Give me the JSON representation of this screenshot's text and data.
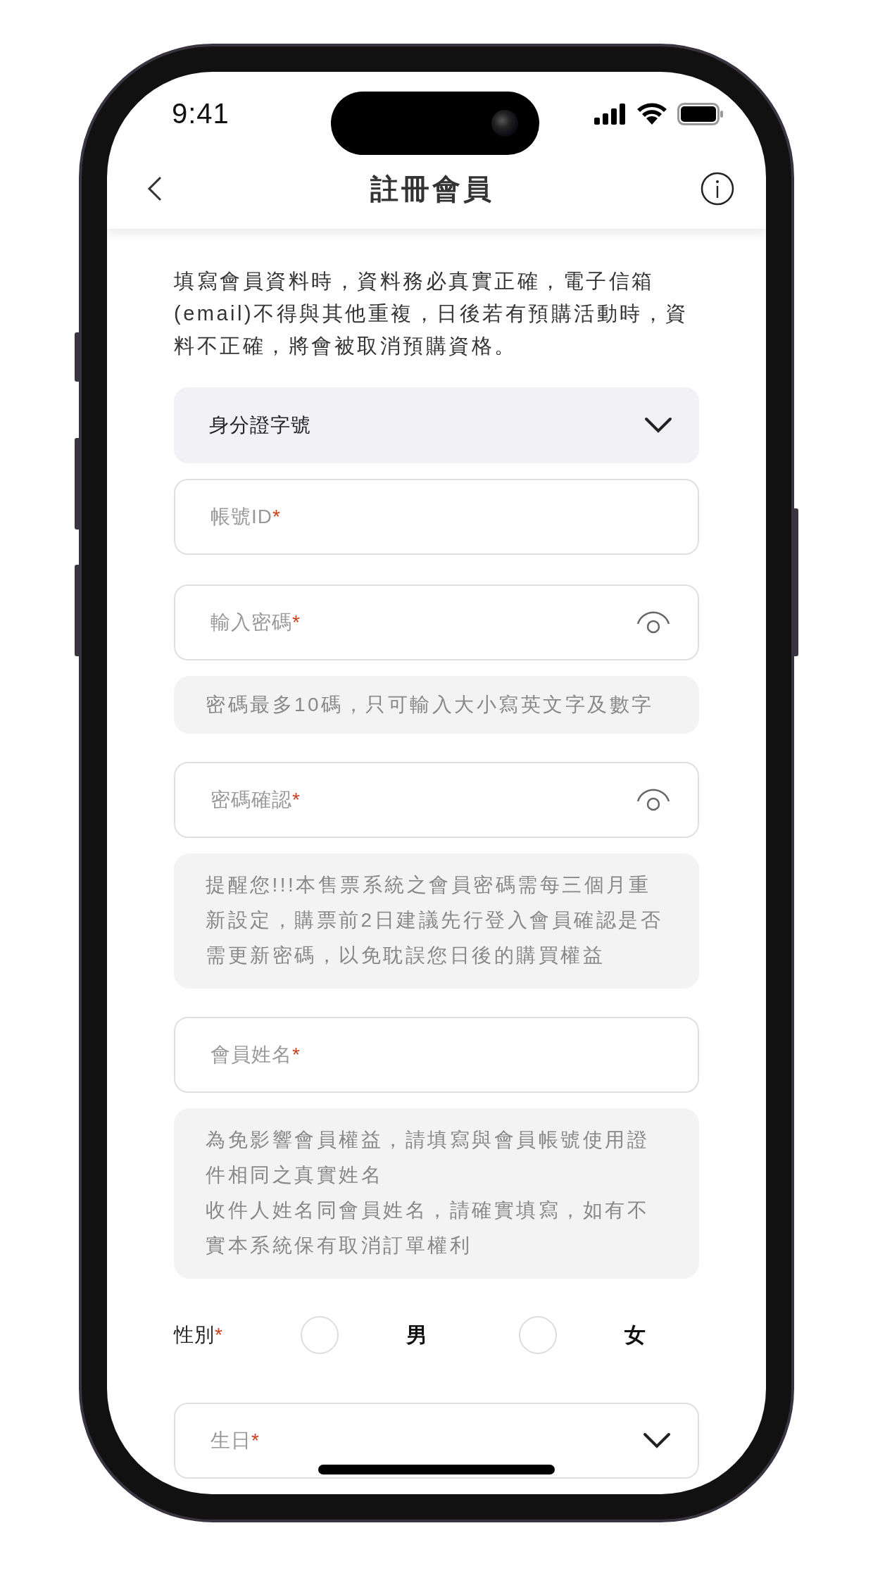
{
  "status_bar": {
    "time": "9:41"
  },
  "header": {
    "title": "註冊會員"
  },
  "intro": "填寫會員資料時，資料務必真實正確，電子信箱(email)不得與其他重複，日後若有預購活動時，資料不正確，將會被取消預購資格。",
  "form": [
    {
      "kind": "select",
      "value": "身分證字號"
    },
    {
      "kind": "input",
      "label": "帳號ID",
      "mark": "*"
    },
    {
      "kind": "password",
      "label": "輸入密碼",
      "mark": "*"
    },
    {
      "kind": "hint",
      "paragraphs": [
        "密碼最多10碼，只可輸入大小寫英文字及數字"
      ]
    },
    {
      "kind": "password",
      "label": "密碼確認",
      "mark": "*"
    },
    {
      "kind": "hint",
      "paragraphs": [
        "提醒您!!!本售票系統之會員密碼需每三個月重新設定，購票前2日建議先行登入會員確認是否需更新密碼，以免耽誤您日後的購買權益"
      ]
    },
    {
      "kind": "input",
      "label": "會員姓名",
      "mark": "*"
    },
    {
      "kind": "hint",
      "paragraphs": [
        "為免影響會員權益，請填寫與會員帳號使用證件相同之真實姓名",
        "收件人姓名同會員姓名，請確實填寫，如有不實本系統保有取消訂單權利"
      ]
    },
    {
      "kind": "radio_group",
      "label": "性別",
      "mark": "*",
      "options": [
        {
          "label": "男",
          "selected": false
        },
        {
          "label": "女",
          "selected": false
        }
      ]
    },
    {
      "kind": "select",
      "label": "生日",
      "mark": "*"
    }
  ]
}
